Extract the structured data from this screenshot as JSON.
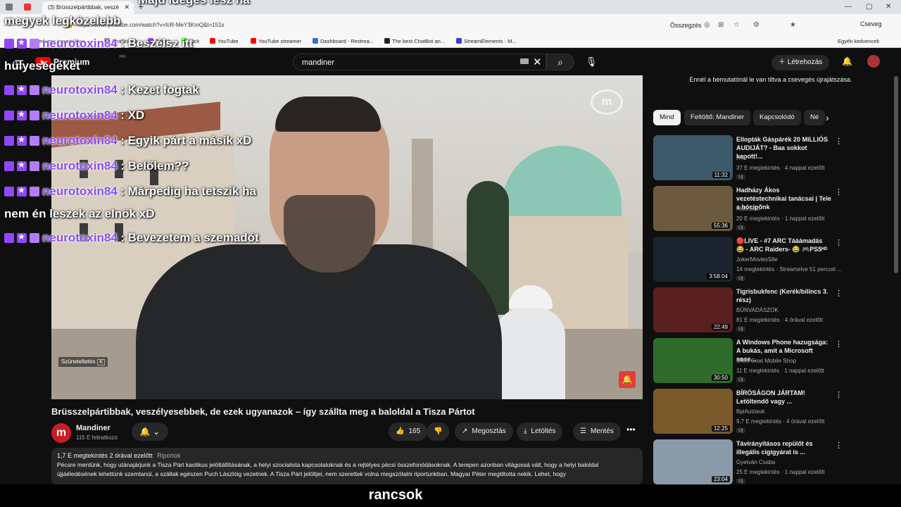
{
  "browser": {
    "tab_title": "(3) Brüsszelpártibbak, veszé",
    "url": "https://www.youtube.com/watch?v=fcR-MeY3KmQ&t=151s",
    "signin_label": "Összegzés",
    "copilot_label": "Cseveg",
    "bookmarks": [
      "Kedvenc importálása",
      "Beállítások",
      "Twitch",
      "Kick",
      "YouTube",
      "YouTube streamer",
      "Dashboard - Restrea...",
      "The best ChatBot an...",
      "StreamElements - M..."
    ],
    "other_bookmarks": "Egyéb kedvencek"
  },
  "youtube": {
    "logo_text": "Premium",
    "logo_region": "HU",
    "search_value": "mandiner",
    "create_label": "Létrehozás",
    "video": {
      "title": "Brüsszelpártibbak, veszélyesebbek, de ezek ugyanazok – így szállta meg a baloldal a Tisza Pártot",
      "watermark": "m",
      "pause_hint": "Szüneteltetés",
      "pause_key": "K"
    },
    "channel": {
      "name": "Mandiner",
      "subs": "115 E feliratkozó",
      "initial": "m"
    },
    "actions": {
      "likes": "165",
      "share": "Megosztás",
      "download": "Letöltés",
      "save": "Mentés"
    },
    "description": {
      "views": "1,7 E megtekintés",
      "ago": "2 órával ezelőtt",
      "tag": "Riportok",
      "text": "Pécsre mentünk, hogy utánajárjunk a Tisza Párt kaotikus jelöltállításának, a helyi szocialista kapcsolatoknak és a rejtélyes pécsi összefonódásoknak. A terepen azonban világossá vált, hogy a helyi baloldal újjáéledésének lehettünk szemtanúi, a szállak egészen Puch Lászlóig vezetnek.  A Tisza Párt jelöltjei, nem szerettek volna megszólalni riportunkban. Magyar Péter megtiltotta nekik. Lehet, hogy"
    },
    "chat_note": "Ennél a bemutatónál le van tiltva a csevegés újrajátszása.",
    "chips": [
      "Mind",
      "Feltöltő: Mandiner",
      "Kapcsolódó",
      "Né"
    ],
    "recommendations": [
      {
        "title": "Ellopták Gáspárék 20 MILLIÓS AUDIJÁT? - Baa sokkot kapott!...",
        "channel": "RTL",
        "meta": "37 E megtekintés · 4 nappal ezelőtt",
        "duration": "11:32",
        "new": "Új",
        "color": "#3d5a6b"
      },
      {
        "title": "Hadházy Ákos vezetéstechnikai tanácsai | Tele a hócipőnk",
        "channel": "Klubrádió",
        "meta": "20 E megtekintés · 1 nappal ezelőtt",
        "duration": "55:36",
        "new": "Új",
        "color": "#6b5a3d"
      },
      {
        "title": "🔴LIVE - #7  ARC Tááámadás 😂 - ARC Raiders- 😂 🎮PS5ᴴᴰ",
        "channel": "JokerMoviesSite",
        "meta": "14 megtekintés · Streamelve 51 perccel ...",
        "duration": "3:58:04",
        "new": "Új",
        "color": "#1c2430"
      },
      {
        "title": "Tigrisbukfenc (Kerék/bilincs 3. rész)",
        "channel": "BŰNVADÁSZOK",
        "meta": "81 E megtekintés · 4 órával ezelőtt",
        "duration": "22:49",
        "new": "Új",
        "color": "#5a1f1f"
      },
      {
        "title": "A Windows Phone hazugsága: A bukás, amit a Microsoft sose...",
        "channel": "GMS-Goat Mobile Shop",
        "meta": "11 E megtekintés · 1 nappal ezelőtt",
        "duration": "30:50",
        "new": "Új",
        "color": "#2f6b2a"
      },
      {
        "title": "BÍRÓSÁGON JÁRTAM! Letöltendő vagy ...",
        "channel": "BpiAutósok",
        "meta": "9,7 E megtekintés · 4 órával ezelőtt",
        "duration": "12:25",
        "new": "Új",
        "color": "#7a5a2a"
      },
      {
        "title": "Távirányításos repülőt és illegális cigigyárat is ...",
        "channel": "Gyetván Csaba",
        "meta": "25 E megtekintés · 1 nappal ezelőtt",
        "duration": "23:04",
        "new": "Új",
        "color": "#8a9aa8"
      }
    ]
  },
  "chat_overlay": {
    "lines": [
      {
        "user": "",
        "msg": "Majd ideges lesz ha",
        "cont": "megyek legközelebb"
      },
      {
        "user": "neurotoxin84",
        "msg": ": Beszélsz itt",
        "cont": "hülyeségeket"
      },
      {
        "user": "neurotoxin84",
        "msg": ": Kezet fogtak",
        "cont": ""
      },
      {
        "user": "neurotoxin84",
        "msg": ": XD",
        "cont": ""
      },
      {
        "user": "neurotoxin84",
        "msg": ": Egyik párt a másik xD",
        "cont": ""
      },
      {
        "user": "neurotoxin84",
        "msg": ": Belőlem??",
        "cont": ""
      },
      {
        "user": "neurotoxin84",
        "msg": ": Márpedig ha tetszik ha",
        "cont": "nem én leszek az elnök xD"
      },
      {
        "user": "neurotoxin84",
        "msg": ": Bevezetem a szemadót",
        "cont": ""
      }
    ]
  },
  "stream_subtitle": "rancsok"
}
